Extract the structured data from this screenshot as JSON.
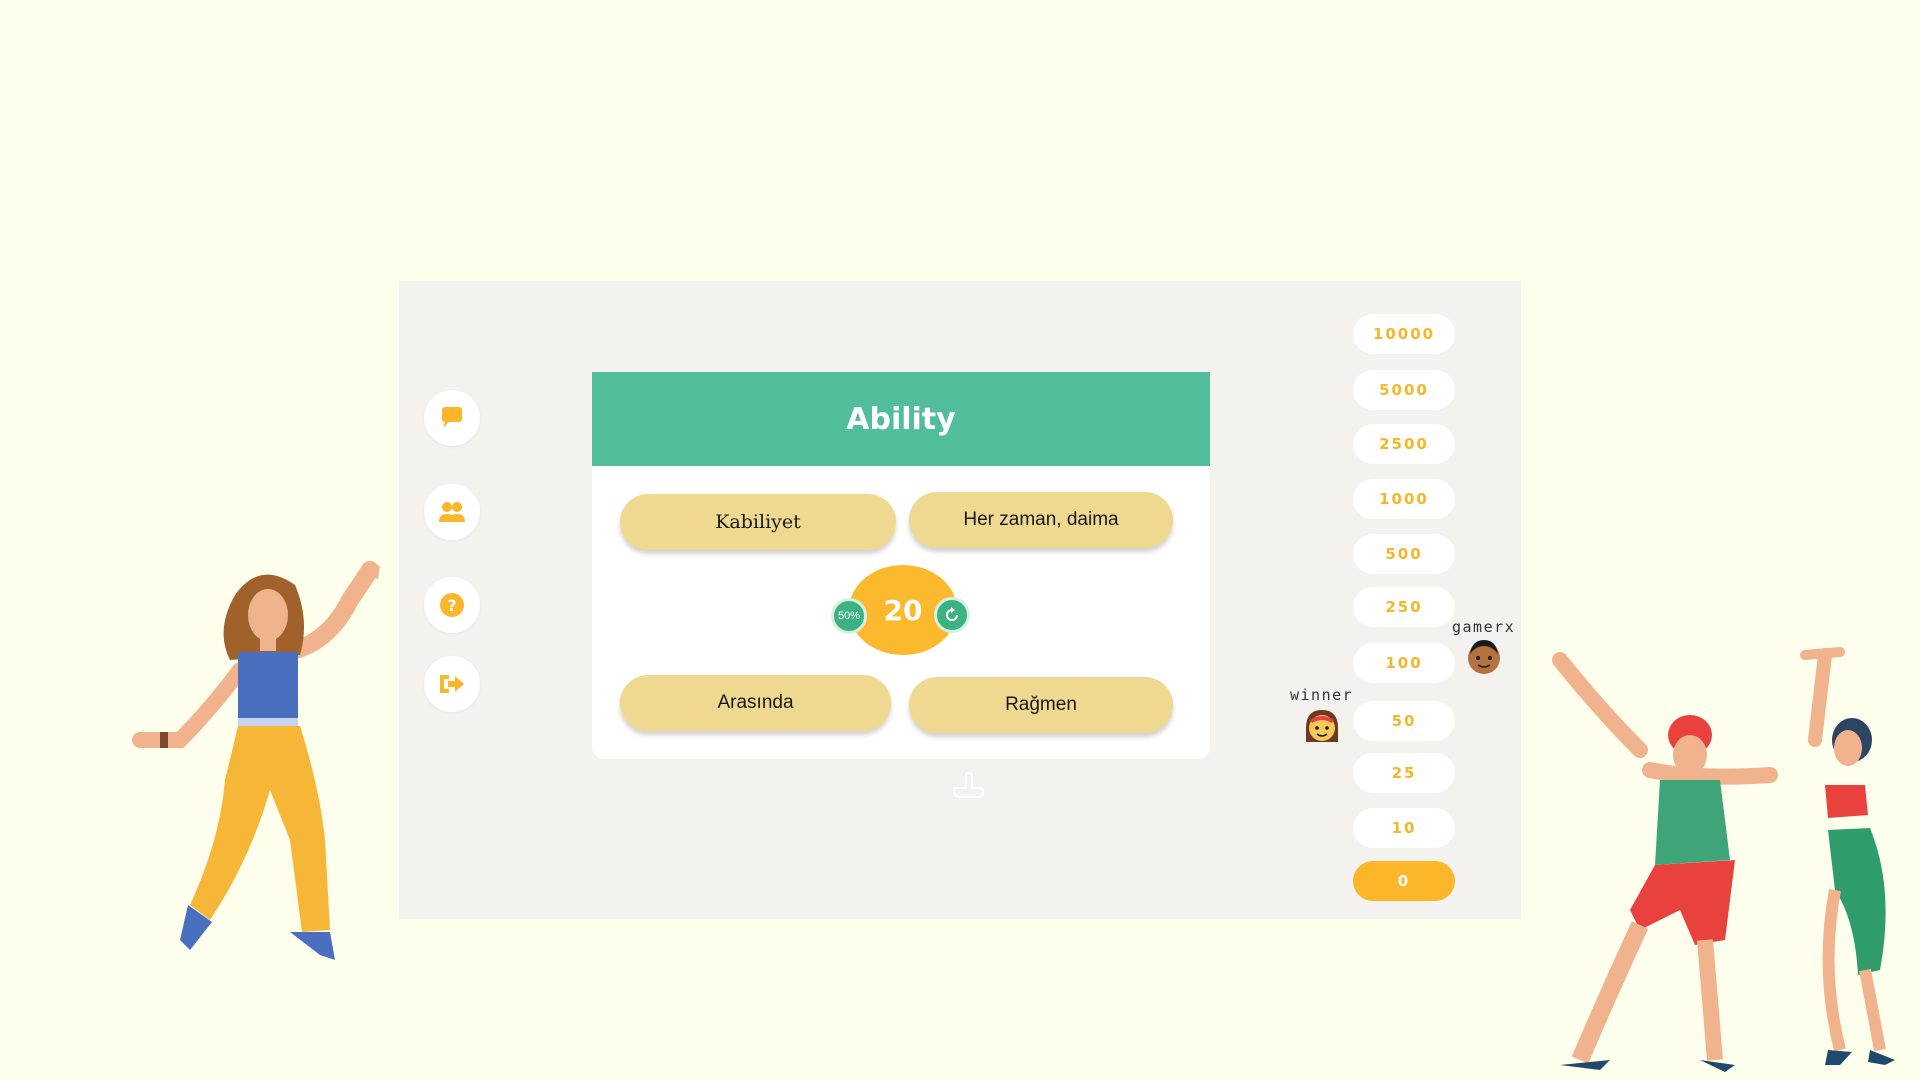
{
  "question": {
    "word": "Ability",
    "answers": [
      {
        "label": "Kabiliyet"
      },
      {
        "label": "Her zaman, daima"
      },
      {
        "label": "Arasında"
      },
      {
        "label": "Rağmen"
      }
    ]
  },
  "timer": {
    "seconds": "20"
  },
  "lifelines": {
    "fifty_label": "50%",
    "refresh_icon": "refresh-icon"
  },
  "sidebar": {
    "icons": [
      "chat-icon",
      "users-icon",
      "help-icon",
      "exit-icon"
    ]
  },
  "prize_ladder": [
    "10000",
    "5000",
    "2500",
    "1000",
    "500",
    "250",
    "100",
    "50",
    "25",
    "10",
    "0"
  ],
  "prize_active_value": "0",
  "players": [
    {
      "name": "gamerx",
      "level": "100"
    },
    {
      "name": "winner",
      "level": "50"
    }
  ],
  "colors": {
    "background": "#fefeec",
    "panel": "#f3f2ef",
    "header_green": "#52bd9b",
    "answer_yellow": "#efd88f",
    "accent_orange": "#fbb629"
  }
}
